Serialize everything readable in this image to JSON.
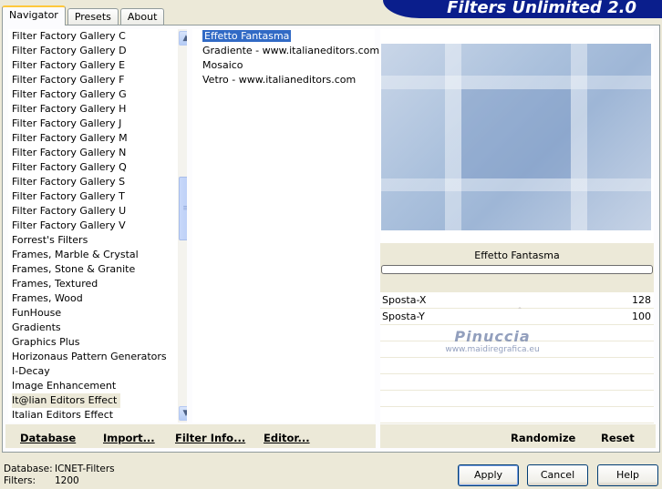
{
  "tabs": [
    "Navigator",
    "Presets",
    "About"
  ],
  "banner_title": "Filters Unlimited 2.0",
  "categories": [
    "Filter Factory Gallery C",
    "Filter Factory Gallery D",
    "Filter Factory Gallery E",
    "Filter Factory Gallery F",
    "Filter Factory Gallery G",
    "Filter Factory Gallery H",
    "Filter Factory Gallery J",
    "Filter Factory Gallery M",
    "Filter Factory Gallery N",
    "Filter Factory Gallery Q",
    "Filter Factory Gallery S",
    "Filter Factory Gallery T",
    "Filter Factory Gallery U",
    "Filter Factory Gallery V",
    "Forrest's Filters",
    "Frames, Marble & Crystal",
    "Frames, Stone & Granite",
    "Frames, Textured",
    "Frames, Wood",
    "FunHouse",
    "Gradients",
    "Graphics Plus",
    "Horizonaus Pattern Generators",
    "I-Decay",
    "Image Enhancement",
    "It@lian Editors Effect",
    "Italian Editors Effect"
  ],
  "selected_category_index": 25,
  "filters": [
    "Effetto Fantasma",
    "Gradiente - www.italianeditors.com",
    "Mosaico",
    "Vetro - www.italianeditors.com"
  ],
  "selected_filter_index": 0,
  "preview_title": "Effetto Fantasma",
  "params": [
    {
      "name": "Sposta-X",
      "value": "128"
    },
    {
      "name": "Sposta-Y",
      "value": "100"
    }
  ],
  "watermark": {
    "line1": "Pinuccia",
    "line2": "www.maidiregrafica.eu"
  },
  "toolbar": {
    "database": "Database",
    "import": "Import...",
    "filter_info": "Filter Info...",
    "editor": "Editor...",
    "randomize": "Randomize",
    "reset": "Reset"
  },
  "footer": {
    "database_label": "Database:",
    "database_value": "ICNET-Filters",
    "filters_label": "Filters:",
    "filters_value": "1200"
  },
  "buttons": {
    "apply": "Apply",
    "cancel": "Cancel",
    "help": "Help"
  }
}
